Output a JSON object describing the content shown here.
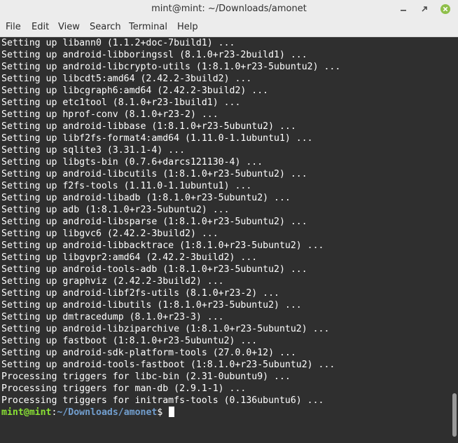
{
  "window": {
    "title": "mint@mint: ~/Downloads/amonet"
  },
  "menu": [
    "File",
    "Edit",
    "View",
    "Search",
    "Terminal",
    "Help"
  ],
  "output_lines": [
    "Setting up libann0 (1.1.2+doc-7build1) ...",
    "Setting up android-libboringssl (8.1.0+r23-2build1) ...",
    "Setting up android-libcrypto-utils (1:8.1.0+r23-5ubuntu2) ...",
    "Setting up libcdt5:amd64 (2.42.2-3build2) ...",
    "Setting up libcgraph6:amd64 (2.42.2-3build2) ...",
    "Setting up etc1tool (8.1.0+r23-1build1) ...",
    "Setting up hprof-conv (8.1.0+r23-2) ...",
    "Setting up android-libbase (1:8.1.0+r23-5ubuntu2) ...",
    "Setting up libf2fs-format4:amd64 (1.11.0-1.1ubuntu1) ...",
    "Setting up sqlite3 (3.31.1-4) ...",
    "Setting up libgts-bin (0.7.6+darcs121130-4) ...",
    "Setting up android-libcutils (1:8.1.0+r23-5ubuntu2) ...",
    "Setting up f2fs-tools (1.11.0-1.1ubuntu1) ...",
    "Setting up android-libadb (1:8.1.0+r23-5ubuntu2) ...",
    "Setting up adb (1:8.1.0+r23-5ubuntu2) ...",
    "Setting up android-libsparse (1:8.1.0+r23-5ubuntu2) ...",
    "Setting up libgvc6 (2.42.2-3build2) ...",
    "Setting up android-libbacktrace (1:8.1.0+r23-5ubuntu2) ...",
    "Setting up libgvpr2:amd64 (2.42.2-3build2) ...",
    "Setting up android-tools-adb (1:8.1.0+r23-5ubuntu2) ...",
    "Setting up graphviz (2.42.2-3build2) ...",
    "Setting up android-libf2fs-utils (8.1.0+r23-2) ...",
    "Setting up android-libutils (1:8.1.0+r23-5ubuntu2) ...",
    "Setting up dmtracedump (8.1.0+r23-3) ...",
    "Setting up android-libziparchive (1:8.1.0+r23-5ubuntu2) ...",
    "Setting up fastboot (1:8.1.0+r23-5ubuntu2) ...",
    "Setting up android-sdk-platform-tools (27.0.0+12) ...",
    "Setting up android-tools-fastboot (1:8.1.0+r23-5ubuntu2) ...",
    "Processing triggers for libc-bin (2.31-0ubuntu9) ...",
    "Processing triggers for man-db (2.9.1-1) ...",
    "Processing triggers for initramfs-tools (0.136ubuntu6) ..."
  ],
  "prompt": {
    "user_host": "mint@mint",
    "sep": ":",
    "path": "~/Downloads/amonet",
    "symbol": "$ "
  },
  "colors": {
    "background": "#2f2f2f",
    "prompt_user": "#8ae234",
    "prompt_path": "#729fcf",
    "close_button": "#8fbf4a"
  }
}
